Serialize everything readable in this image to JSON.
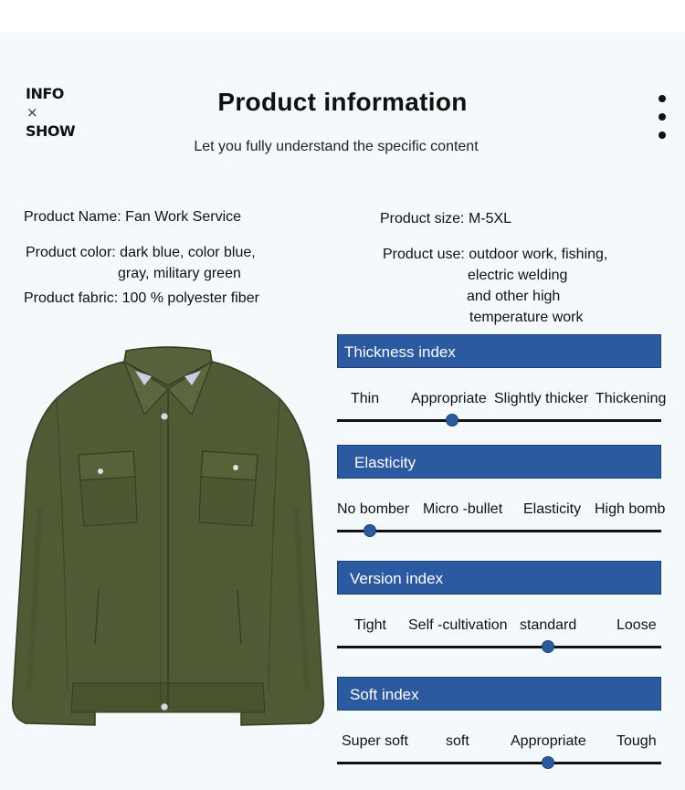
{
  "header": {
    "brand_top": "INFO",
    "brand_x": "×",
    "brand_bottom": "SHOW",
    "title": "Product information",
    "subtitle": "Let you fully understand the specific content"
  },
  "info": {
    "name_label": "Product Name:",
    "name_value": "Fan Work Service",
    "color_label": "Product color:",
    "color_value_1": "dark blue, color blue,",
    "color_value_2": "gray, military green",
    "fabric_label": "Product fabric:",
    "fabric_value": "100 % polyester fiber",
    "size_label": "Product size:",
    "size_value": "M-5XL",
    "use_label": "Product use:",
    "use_value_1": "outdoor work, fishing,",
    "use_value_2": "electric welding",
    "use_value_3": "and other high",
    "use_value_4": "temperature work"
  },
  "indices": [
    {
      "title": "Thickness index",
      "labels": [
        "Thin",
        "Appropriate",
        "Slightly thicker",
        "Thickening"
      ],
      "selected_level": 2
    },
    {
      "title": "Elasticity",
      "labels": [
        "No bomber",
        "Micro -bullet",
        "Elasticity",
        "High bomb"
      ],
      "selected_level": 1
    },
    {
      "title": "Version index",
      "labels": [
        "Tight",
        "Self -cultivation",
        "standard",
        "Loose"
      ],
      "selected_level": 3
    },
    {
      "title": "Soft index",
      "labels": [
        "Super soft",
        "soft",
        "Appropriate",
        "Tough"
      ],
      "selected_level": 3
    }
  ],
  "colors": {
    "accent": "#2c5aa0",
    "jacket": "#4e5a34",
    "background": "#f4f9fc"
  }
}
